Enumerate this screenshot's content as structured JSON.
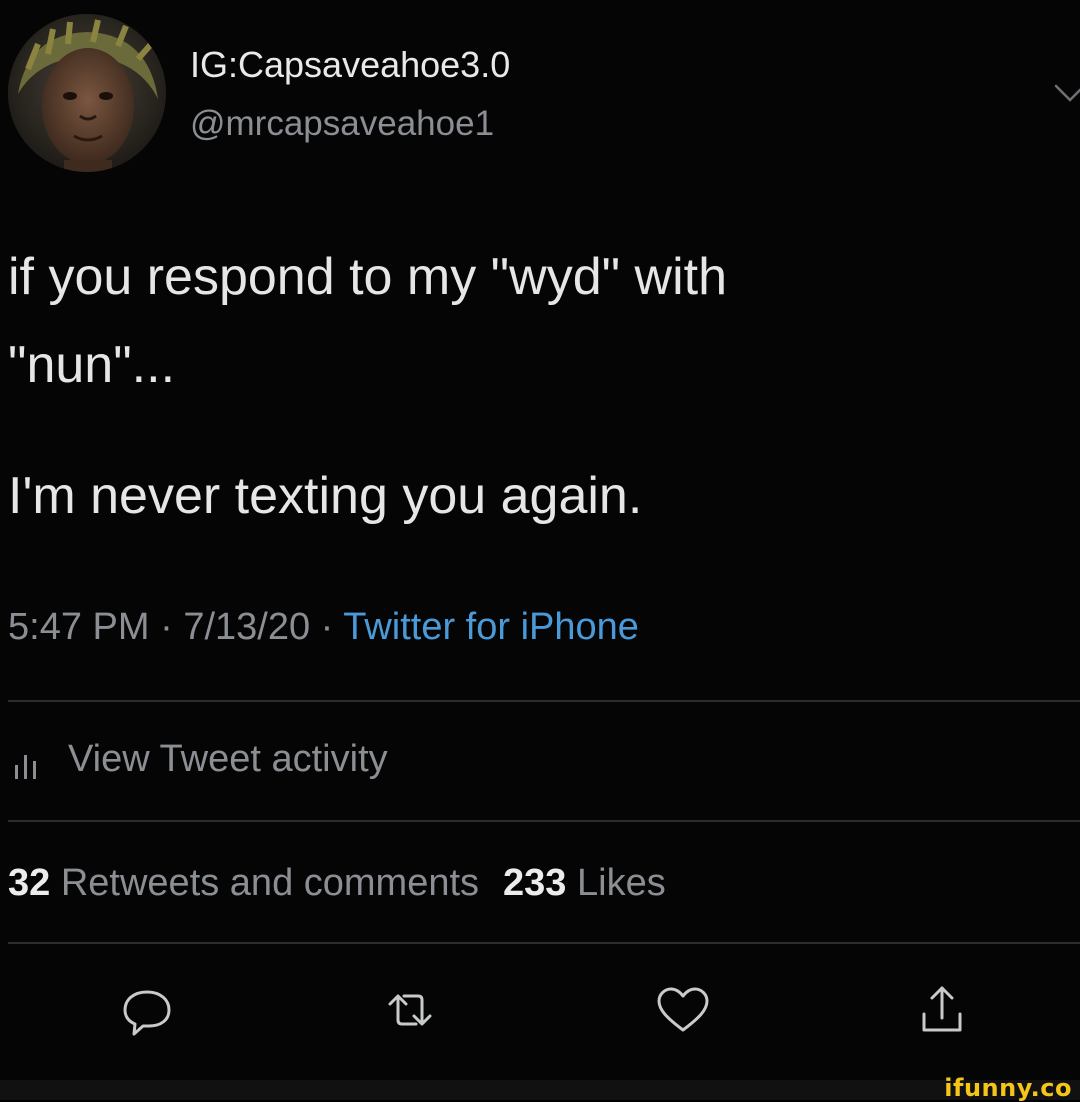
{
  "user": {
    "display_name": "IG:Capsaveahoe3.0",
    "handle": "@mrcapsaveahoe1"
  },
  "tweet": {
    "lines": [
      "if you respond to my \"wyd\" with",
      "\"nun\"...",
      "I'm never texting you again."
    ],
    "time": "5:47 PM",
    "date": "7/13/20",
    "separator": " · ",
    "source": "Twitter for iPhone"
  },
  "activity": {
    "label": "View Tweet activity"
  },
  "stats": {
    "retweets_count": "32",
    "retweets_label": "Retweets and comments",
    "likes_count": "233",
    "likes_label": "Likes"
  },
  "icons": {
    "avatar": "profile-photo",
    "menu": "chevron-down-icon",
    "activity": "bar-chart-icon",
    "reply": "reply-icon",
    "retweet": "retweet-icon",
    "like": "heart-icon",
    "share": "share-icon"
  },
  "colors": {
    "background": "#050505",
    "link": "#4a9ad9",
    "muted": "#8b8f94",
    "watermark": "#f5c518"
  },
  "watermark": "ifunny.co"
}
